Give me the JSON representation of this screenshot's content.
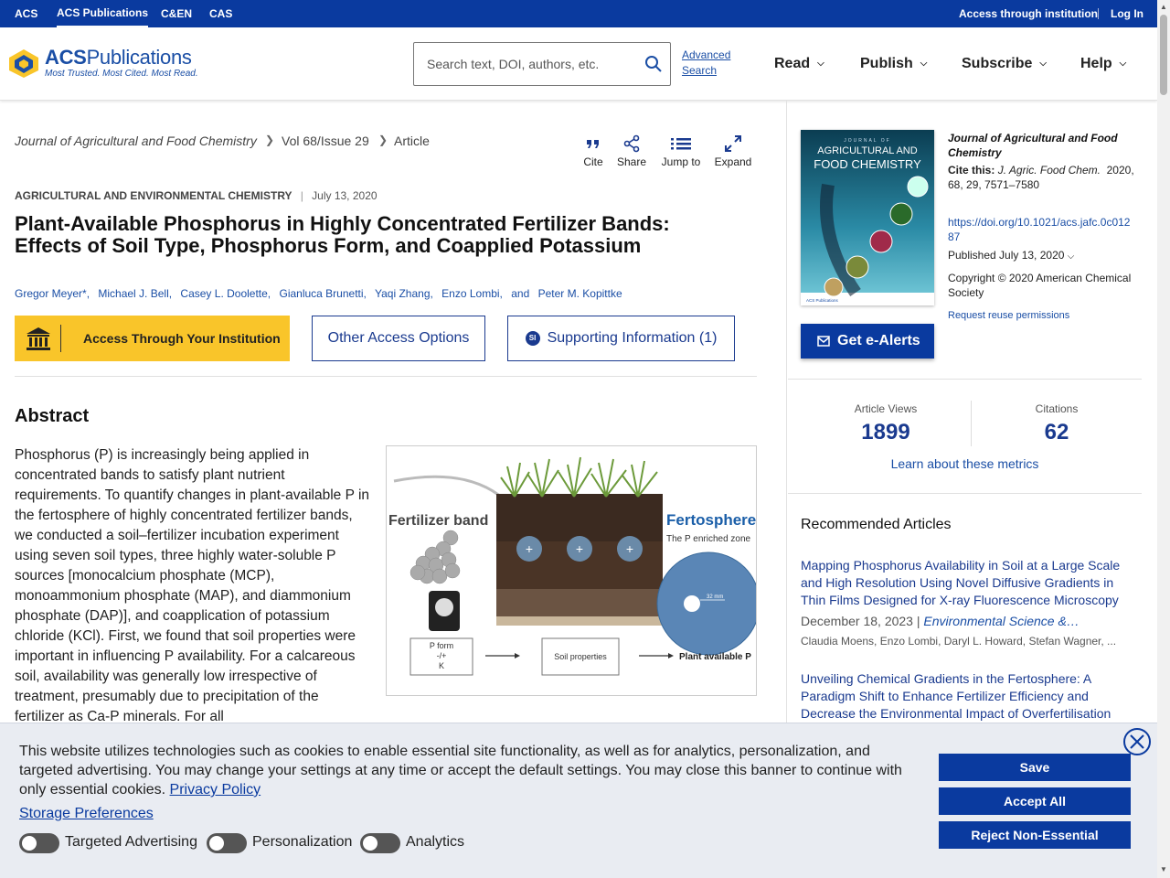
{
  "topbar": {
    "links": [
      "ACS",
      "ACS Publications",
      "C&EN",
      "CAS"
    ],
    "access": "Access through institution",
    "login": "Log In"
  },
  "header": {
    "logo_name_bold": "ACS",
    "logo_name_rest": "Publications",
    "logo_tagline": "Most Trusted. Most Cited. Most Read.",
    "search_placeholder": "Search text, DOI, authors, etc.",
    "advanced_line1": "Advanced",
    "advanced_line2": "Search",
    "nav": [
      "Read",
      "Publish",
      "Subscribe",
      "Help"
    ]
  },
  "breadcrumb": {
    "journal": "Journal of Agricultural and Food Chemistry",
    "volume": "Vol 68/Issue 29",
    "type": "Article"
  },
  "tools": [
    "Cite",
    "Share",
    "Jump to",
    "Expand"
  ],
  "article": {
    "section": "AGRICULTURAL AND ENVIRONMENTAL CHEMISTRY",
    "date": "July 13, 2020",
    "title_line1": "Plant-Available Phosphorus in Highly Concentrated Fertilizer Bands:",
    "title_line2": "Effects of Soil Type, Phosphorus Form, and Coapplied Potassium",
    "authors": [
      "Gregor Meyer*,",
      "Michael J. Bell,",
      "Casey L. Doolette,",
      "Gianluca Brunetti,",
      "Yaqi Zhang,",
      "Enzo Lombi,",
      "and",
      "Peter M. Kopittke"
    ],
    "access_btn": "Access Through Your Institution",
    "other_btn": "Other Access Options",
    "si_btn": "Supporting Information (1)",
    "abstract_heading": "Abstract",
    "abstract": "Phosphorus (P) is increasingly being applied in concentrated bands to satisfy plant nutrient requirements. To quantify changes in plant-available P in the fertosphere of highly concentrated fertilizer bands, we conducted a soil–fertilizer incubation experiment using seven soil types, three highly water-soluble P sources [monocalcium phosphate (MCP), monoammonium phosphate (MAP), and diammonium phosphate (DAP)], and coapplication of potassium chloride (KCl). First, we found that soil properties were important in influencing P availability. For a calcareous soil, availability was generally low irrespective of treatment, presumably due to precipitation of the fertilizer as Ca-P minerals. For all"
  },
  "toc_graphic": {
    "band_label": "Fertilizer band",
    "fertosphere": "Fertosphere",
    "fertosphere_sub": "The P enriched zone",
    "scale": "32 mm",
    "pform": "P form",
    "pform2": "-/+",
    "pform3": "K",
    "soil_props": "Soil properties",
    "plant_p": "Plant available P"
  },
  "sidebar": {
    "cover_title1": "AGRICULTURAL AND",
    "cover_title2": "FOOD CHEMISTRY",
    "cover_journal": "JOURNAL OF",
    "cover_footer": "ACS Publications",
    "journal": "Journal of Agricultural and Food Chemistry",
    "cite_label": "Cite this:",
    "cite_journal": "J. Agric. Food Chem.",
    "cite_rest": "2020, 68, 29, 7571–7580",
    "doi": "https://doi.org/10.1021/acs.jafc.0c01287",
    "published": "Published July 13, 2020",
    "copyright": "Copyright © 2020 American Chemical Society",
    "reuse": "Request reuse permissions",
    "ealerts": "Get e-Alerts",
    "views_label": "Article Views",
    "views": "1899",
    "citations_label": "Citations",
    "citations": "62",
    "learn": "Learn about these metrics",
    "recommended": "Recommended Articles",
    "rec": [
      {
        "title": "Mapping Phosphorus Availability in Soil at a Large Scale and High Resolution Using Novel Diffusive Gradients in Thin Films Designed for X-ray Fluorescence Microscopy",
        "date": "December 18, 2023",
        "journal": "Environmental Science &…",
        "authors": "Claudia Moens, Enzo Lombi, Daryl L. Howard, Stefan Wagner, ..."
      },
      {
        "title": "Unveiling Chemical Gradients in the Fertosphere: A Paradigm Shift to Enhance Fertilizer Efficiency and Decrease the Environmental Impact of Overfertilisation"
      }
    ]
  },
  "cookie": {
    "text": "This website utilizes technologies such as cookies to enable essential site functionality, as well as for analytics, personalization, and targeted advertising. You may change your settings at any time or accept the default settings. You may close this banner to continue with only essential cookies.",
    "privacy": "Privacy Policy",
    "storage": "Storage Preferences",
    "toggles": [
      "Targeted Advertising",
      "Personalization",
      "Analytics"
    ],
    "save": "Save",
    "accept": "Accept All",
    "reject": "Reject Non-Essential"
  },
  "colors": {
    "brand_blue": "#0a3a9f",
    "access_yellow": "#f9c52a",
    "link_blue": "#1a4ea5"
  }
}
